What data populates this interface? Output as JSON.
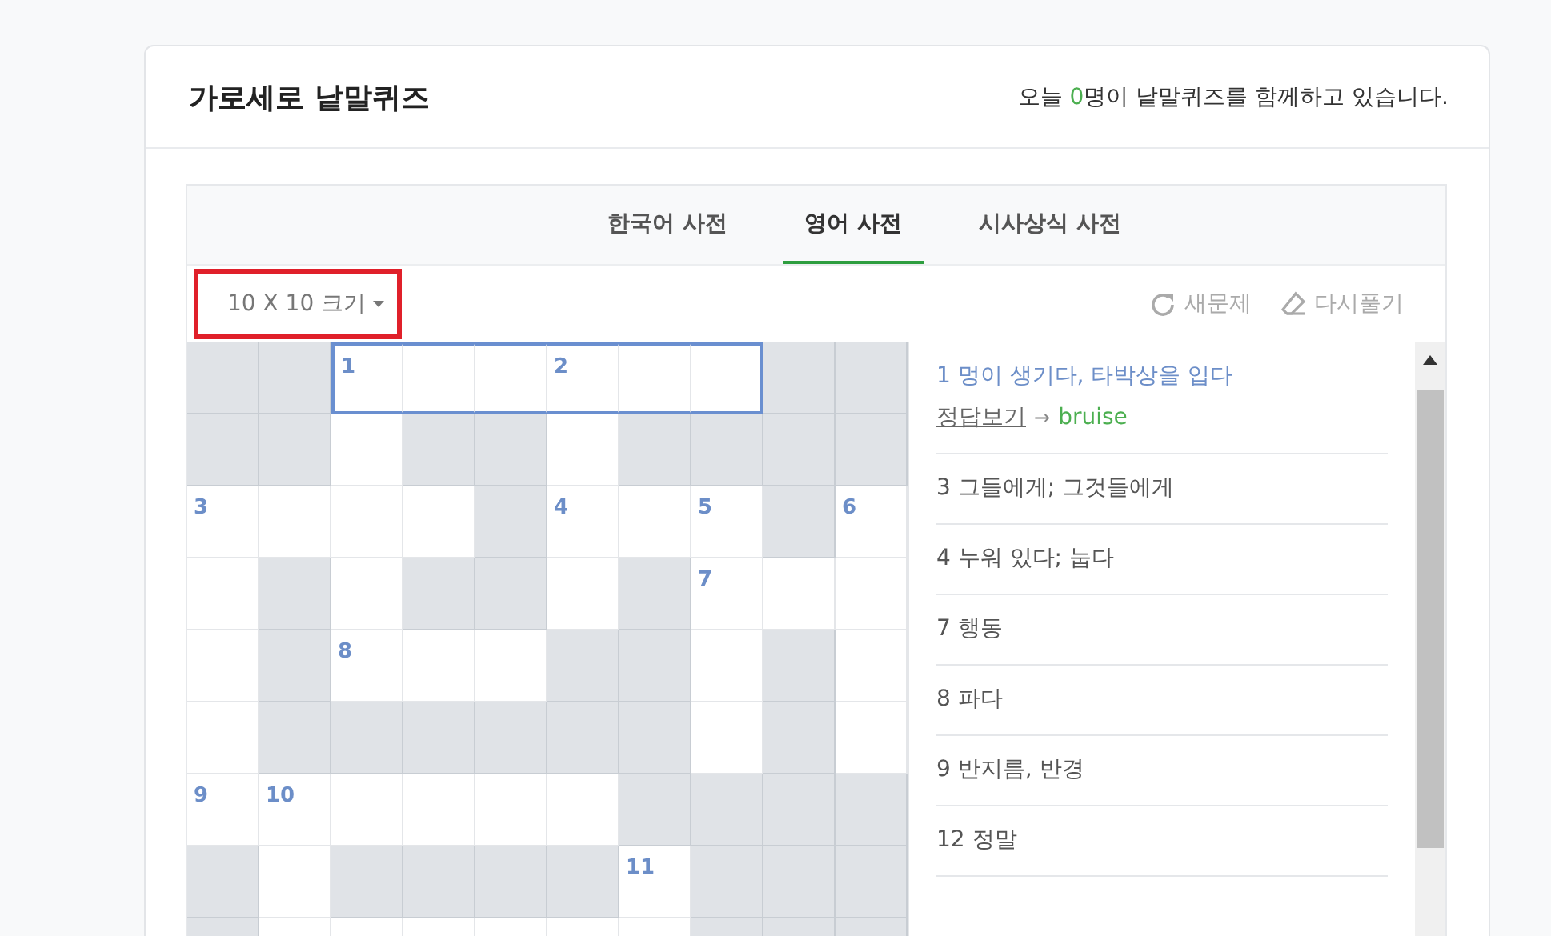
{
  "header": {
    "title": "가로세로 낱말퀴즈",
    "online": {
      "before": "오늘 ",
      "count": "0",
      "after": "명이 낱말퀴즈를 함께하고 있습니다."
    }
  },
  "tabs": [
    {
      "label": "한국어 사전",
      "selected": false
    },
    {
      "label": "영어 사전",
      "selected": true
    },
    {
      "label": "시사상식 사전",
      "selected": false
    }
  ],
  "toolbar": {
    "size_dropdown": {
      "label": "10 X 10 크기",
      "highlighted": true
    },
    "buttons": [
      {
        "kind": "refresh",
        "label": "새문제"
      },
      {
        "kind": "erase",
        "label": "다시풀기"
      }
    ]
  },
  "grid": {
    "rows": [
      [
        {
          "open": false,
          "selected": false
        },
        {
          "open": false,
          "selected": false
        },
        {
          "open": true,
          "selected": true,
          "number": "1"
        },
        {
          "open": true,
          "selected": true
        },
        {
          "open": true,
          "selected": true
        },
        {
          "open": true,
          "selected": true,
          "number": "2"
        },
        {
          "open": true,
          "selected": true
        },
        {
          "open": true,
          "selected": true
        },
        {
          "open": false,
          "selected": false
        },
        {
          "open": false,
          "selected": false
        }
      ],
      [
        {
          "open": false,
          "selected": false
        },
        {
          "open": false,
          "selected": false
        },
        {
          "open": true,
          "selected": false
        },
        {
          "open": false,
          "selected": false
        },
        {
          "open": false,
          "selected": false
        },
        {
          "open": true,
          "selected": false
        },
        {
          "open": false,
          "selected": false
        },
        {
          "open": false,
          "selected": false
        },
        {
          "open": false,
          "selected": false
        },
        {
          "open": false,
          "selected": false
        }
      ],
      [
        {
          "open": true,
          "selected": false,
          "number": "3"
        },
        {
          "open": true,
          "selected": false
        },
        {
          "open": true,
          "selected": false
        },
        {
          "open": true,
          "selected": false
        },
        {
          "open": false,
          "selected": false
        },
        {
          "open": true,
          "selected": false,
          "number": "4"
        },
        {
          "open": true,
          "selected": false
        },
        {
          "open": true,
          "selected": false,
          "number": "5"
        },
        {
          "open": false,
          "selected": false
        },
        {
          "open": true,
          "selected": false,
          "number": "6"
        }
      ],
      [
        {
          "open": true,
          "selected": false
        },
        {
          "open": false,
          "selected": false
        },
        {
          "open": true,
          "selected": false
        },
        {
          "open": false,
          "selected": false
        },
        {
          "open": false,
          "selected": false
        },
        {
          "open": true,
          "selected": false
        },
        {
          "open": false,
          "selected": false
        },
        {
          "open": true,
          "selected": false,
          "number": "7"
        },
        {
          "open": true,
          "selected": false
        },
        {
          "open": true,
          "selected": false
        }
      ],
      [
        {
          "open": true,
          "selected": false
        },
        {
          "open": false,
          "selected": false
        },
        {
          "open": true,
          "selected": false,
          "number": "8"
        },
        {
          "open": true,
          "selected": false
        },
        {
          "open": true,
          "selected": false
        },
        {
          "open": false,
          "selected": false
        },
        {
          "open": false,
          "selected": false
        },
        {
          "open": true,
          "selected": false
        },
        {
          "open": false,
          "selected": false
        },
        {
          "open": true,
          "selected": false
        }
      ],
      [
        {
          "open": true,
          "selected": false
        },
        {
          "open": false,
          "selected": false
        },
        {
          "open": false,
          "selected": false
        },
        {
          "open": false,
          "selected": false
        },
        {
          "open": false,
          "selected": false
        },
        {
          "open": false,
          "selected": false
        },
        {
          "open": false,
          "selected": false
        },
        {
          "open": true,
          "selected": false
        },
        {
          "open": false,
          "selected": false
        },
        {
          "open": true,
          "selected": false
        }
      ],
      [
        {
          "open": true,
          "selected": false,
          "number": "9"
        },
        {
          "open": true,
          "selected": false,
          "number": "10"
        },
        {
          "open": true,
          "selected": false
        },
        {
          "open": true,
          "selected": false
        },
        {
          "open": true,
          "selected": false
        },
        {
          "open": true,
          "selected": false
        },
        {
          "open": false,
          "selected": false
        },
        {
          "open": false,
          "selected": false
        },
        {
          "open": false,
          "selected": false
        },
        {
          "open": false,
          "selected": false
        }
      ],
      [
        {
          "open": false,
          "selected": false
        },
        {
          "open": true,
          "selected": false
        },
        {
          "open": false,
          "selected": false
        },
        {
          "open": false,
          "selected": false
        },
        {
          "open": false,
          "selected": false
        },
        {
          "open": false,
          "selected": false
        },
        {
          "open": true,
          "selected": false,
          "number": "11"
        },
        {
          "open": false,
          "selected": false
        },
        {
          "open": false,
          "selected": false
        },
        {
          "open": false,
          "selected": false
        }
      ],
      [
        {
          "open": false,
          "selected": false
        },
        {
          "open": true,
          "selected": false
        },
        {
          "open": true,
          "selected": false
        },
        {
          "open": true,
          "selected": false
        },
        {
          "open": true,
          "selected": false
        },
        {
          "open": true,
          "selected": false
        },
        {
          "open": true,
          "selected": false
        },
        {
          "open": false,
          "selected": false
        },
        {
          "open": false,
          "selected": false
        },
        {
          "open": false,
          "selected": false
        }
      ]
    ]
  },
  "clues": [
    {
      "number": "1",
      "text": "멍이 생기다, 타박상을 입다",
      "selected": true,
      "reveal_link": "정답보기",
      "arrow": "→",
      "answer": "bruise"
    },
    {
      "number": "3",
      "text": "그들에게; 그것들에게",
      "selected": false
    },
    {
      "number": "4",
      "text": "누워 있다; 눕다",
      "selected": false
    },
    {
      "number": "7",
      "text": "행동",
      "selected": false
    },
    {
      "number": "8",
      "text": "파다",
      "selected": false
    },
    {
      "number": "9",
      "text": "반지름, 반경",
      "selected": false
    },
    {
      "number": "12",
      "text": "정말",
      "selected": false
    }
  ]
}
